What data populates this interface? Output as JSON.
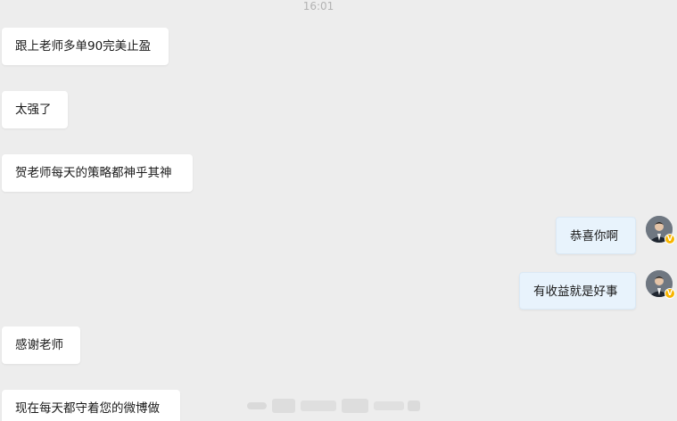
{
  "timestamp": "16:01",
  "messages": [
    {
      "side": "in",
      "text": "跟上老师多单90完美止盈"
    },
    {
      "side": "in",
      "text": "太强了"
    },
    {
      "side": "in",
      "text": "贺老师每天的策略都神乎其神"
    },
    {
      "side": "out",
      "text": "恭喜你啊"
    },
    {
      "side": "out",
      "text": "有收益就是好事"
    },
    {
      "side": "in",
      "text": "感谢老师"
    },
    {
      "side": "in",
      "text": "现在每天都守着您的微博做"
    }
  ],
  "avatar": {
    "badge": "V",
    "badge_color": "#f7b500"
  },
  "colors": {
    "background": "#ededed",
    "incoming_bubble": "#ffffff",
    "outgoing_bubble": "#e8f3fc"
  }
}
